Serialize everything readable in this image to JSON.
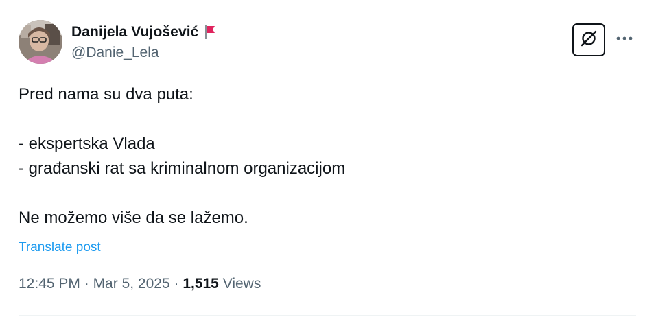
{
  "author": {
    "display_name": "Danijela Vujošević",
    "handle": "@Danie_Lela",
    "flag_icon": "red-flag-icon"
  },
  "actions": {
    "grok_icon": "grok-icon",
    "more_icon": "more-dots-icon"
  },
  "post": {
    "lines": [
      "Pred nama su dva puta:",
      "",
      "- ekspertska Vlada",
      "- građanski rat sa kriminalnom organizacijom",
      "",
      "Ne možemo više da se lažemo."
    ],
    "translate_label": "Translate post"
  },
  "meta": {
    "time": "12:45 PM",
    "separator": " · ",
    "date": "Mar 5, 2025",
    "views_count": "1,515",
    "views_label": " Views"
  },
  "colors": {
    "text": "#0f1419",
    "secondary": "#536471",
    "link": "#1d9bf0",
    "flag": "#e0245e"
  }
}
